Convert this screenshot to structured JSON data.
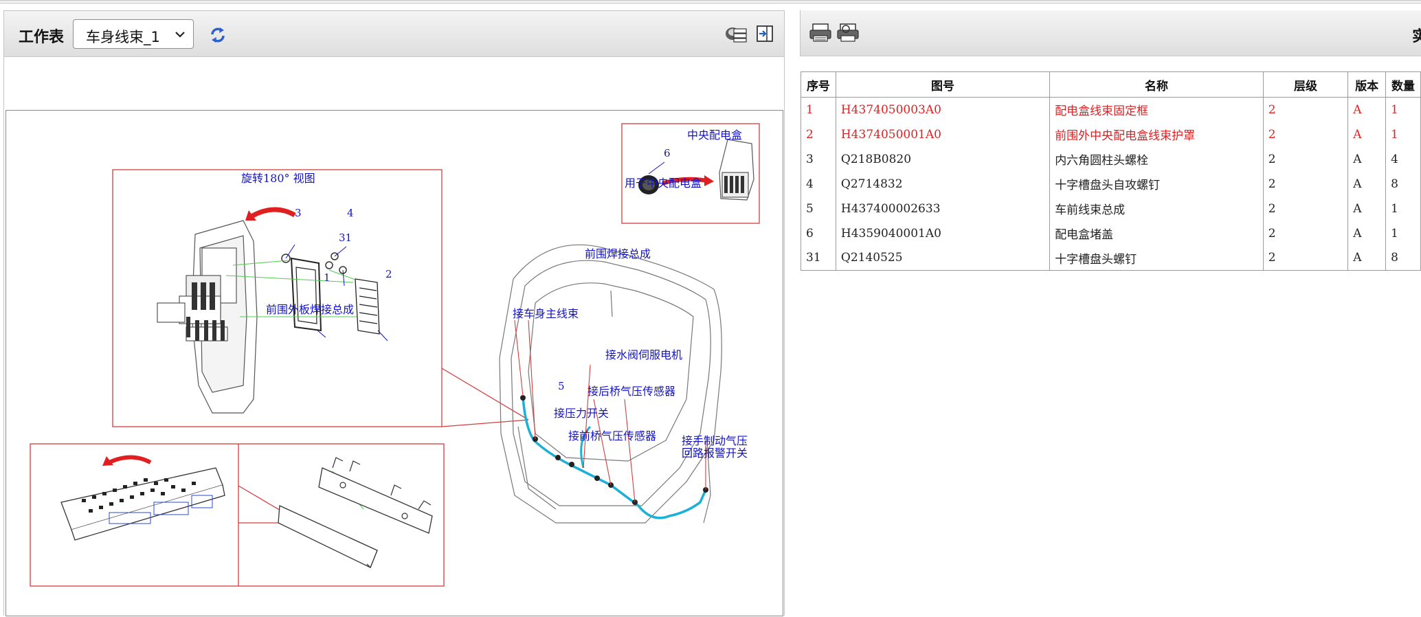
{
  "worksheet": {
    "label": "工作表",
    "selected": "车身线束_1",
    "refresh_icon": "refresh-icon",
    "tool_icons": [
      "layers-icon",
      "export-panel-icon"
    ]
  },
  "drawing": {
    "labels": {
      "rotate_view": "旋转180° 视图",
      "central_box": "中央配电盒",
      "for_central_box": "用于中央配电盒",
      "front_panel_weld": "前围焊接总成",
      "front_outer_panel_weld": "前围外板焊接总成",
      "main_harness": "接车身主线束",
      "water_valve_motor": "接水阀伺服电机",
      "rear_axle_sensor": "接后桥气压传感器",
      "pressure_switch": "接压力开关",
      "front_axle_sensor": "接前桥气压传感器",
      "hand_brake_line1": "接手制动气压",
      "hand_brake_line2": "回路报警开关"
    },
    "callouts": {
      "n1": "1",
      "n2": "2",
      "n3": "3",
      "n4": "4",
      "n5": "5",
      "n6": "6",
      "n31": "31"
    }
  },
  "right_toolbar": {
    "icons": [
      "print-icon",
      "print-preview-icon"
    ],
    "cut_text": "实"
  },
  "table": {
    "headers": [
      "序号",
      "图号",
      "名称",
      "层级",
      "版本",
      "数量"
    ],
    "rows": [
      {
        "seq": "1",
        "code": "H4374050003A0",
        "name": "配电盒线束固定框",
        "level": "2",
        "ver": "A",
        "qty": "1",
        "highlight": true
      },
      {
        "seq": "2",
        "code": "H4374050001A0",
        "name": "前围外中央配电盒线束护罩",
        "level": "2",
        "ver": "A",
        "qty": "1",
        "highlight": true
      },
      {
        "seq": "3",
        "code": "Q218B0820",
        "name": "内六角圆柱头螺栓",
        "level": "2",
        "ver": "A",
        "qty": "4",
        "highlight": false
      },
      {
        "seq": "4",
        "code": "Q2714832",
        "name": "十字槽盘头自攻螺钉",
        "level": "2",
        "ver": "A",
        "qty": "8",
        "highlight": false
      },
      {
        "seq": "5",
        "code": "H437400002633",
        "name": "车前线束总成",
        "level": "2",
        "ver": "A",
        "qty": "1",
        "highlight": false
      },
      {
        "seq": "6",
        "code": "H4359040001A0",
        "name": "配电盒堵盖",
        "level": "2",
        "ver": "A",
        "qty": "1",
        "highlight": false
      },
      {
        "seq": "31",
        "code": "Q2140525",
        "name": "十字槽盘头螺钉",
        "level": "2",
        "ver": "A",
        "qty": "8",
        "highlight": false
      }
    ]
  },
  "colors": {
    "highlight_red": "#e02020",
    "label_blue": "#1313c4",
    "harness_cyan": "#1ab0d8",
    "frame_red": "#d43b3b"
  }
}
